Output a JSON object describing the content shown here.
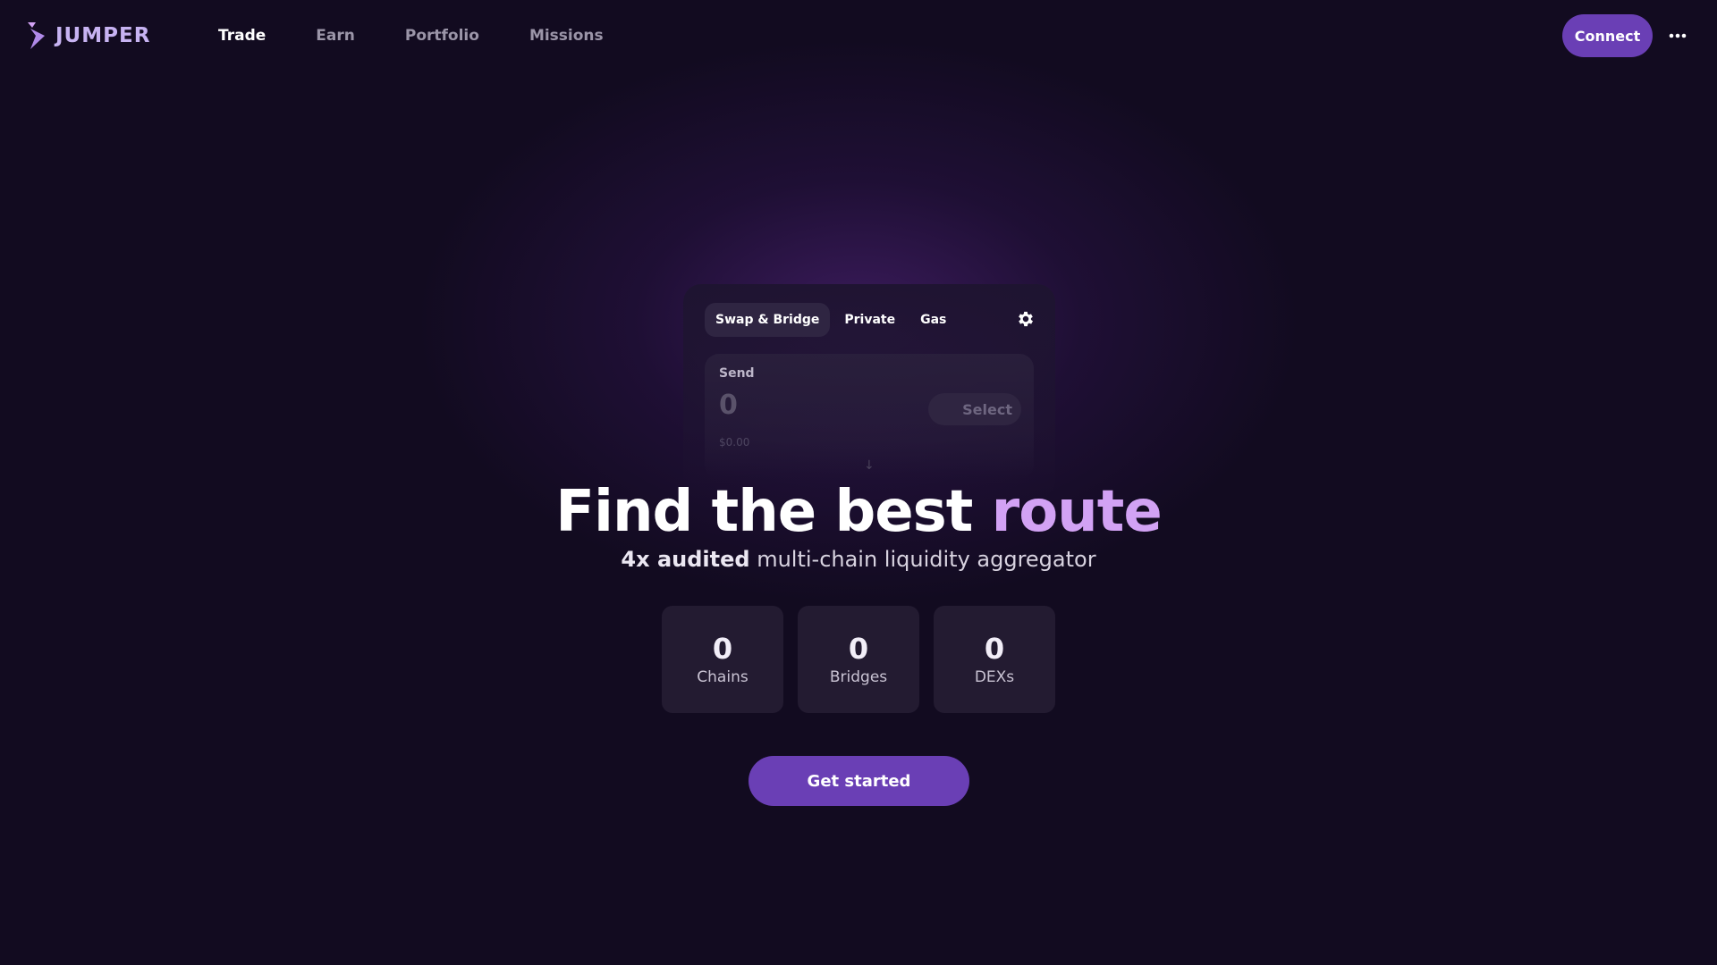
{
  "brand": {
    "name": "JUMPER",
    "accent": "#6a3fb5",
    "highlight": "#d2a2f4"
  },
  "nav": {
    "items": [
      {
        "label": "Trade",
        "active": true
      },
      {
        "label": "Earn",
        "active": false
      },
      {
        "label": "Portfolio",
        "active": false
      },
      {
        "label": "Missions",
        "active": false
      }
    ]
  },
  "header": {
    "connect_label": "Connect",
    "more_icon": "more-horizontal-icon"
  },
  "widget": {
    "tabs": [
      {
        "label": "Swap & Bridge",
        "active": true
      },
      {
        "label": "Private",
        "active": false
      },
      {
        "label": "Gas",
        "active": false
      }
    ],
    "settings_icon": "gear-icon",
    "send": {
      "label": "Send",
      "amount": "0",
      "select_label": "Select",
      "usd_value": "$0.00"
    },
    "swap_direction_icon": "arrow-down-icon"
  },
  "hero": {
    "title_main": "Find the best ",
    "title_accent": "route",
    "subtitle_bold": "4x audited",
    "subtitle_rest": " multi-chain liquidity aggregator"
  },
  "stats": [
    {
      "value": "0",
      "label": "Chains"
    },
    {
      "value": "0",
      "label": "Bridges"
    },
    {
      "value": "0",
      "label": "DEXs"
    }
  ],
  "cta": {
    "label": "Get started"
  }
}
